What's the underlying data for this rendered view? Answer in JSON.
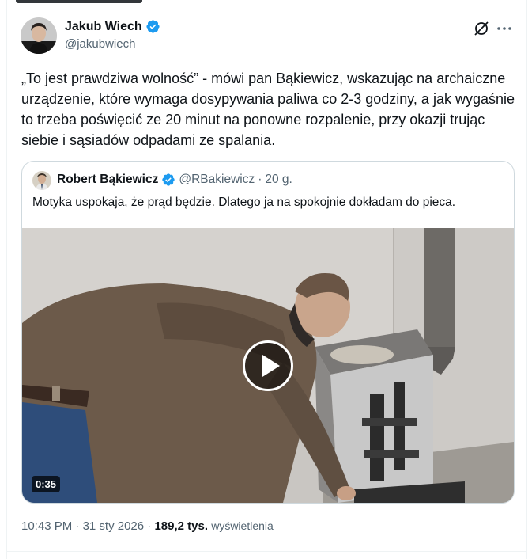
{
  "tweet": {
    "author": {
      "display_name": "Jakub Wiech",
      "handle": "@jakubwiech",
      "verified": true
    },
    "text": "„To jest prawdziwa wolność” - mówi pan Bąkiewicz, wskazując na archaiczne urządzenie, które wymaga dosypywania paliwa co 2-3 godziny, a jak wygaśnie to trzeba poświęcić ze 20 minut na ponowne rozpalenie, przy okazji trując siebie i sąsiadów odpadami ze spalania.",
    "actions": {
      "grok_icon": "grok-icon",
      "more_icon": "more-icon"
    }
  },
  "quote": {
    "author": {
      "display_name": "Robert Bąkiewicz",
      "handle": "@RBakiewicz",
      "separator": "·",
      "time": "20 g.",
      "verified": true
    },
    "text": "Motyka uspokaja, że prąd będzie. Dlatego ja na spokojnie dokładam do pieca.",
    "video": {
      "duration": "0:35",
      "play_icon": "play-icon"
    }
  },
  "meta": {
    "time": "10:43 PM",
    "sep1": "·",
    "date": "31 sty 2026",
    "sep2": "·",
    "views_count": "189,2 tys.",
    "views_label": "wyświetlenia"
  },
  "colors": {
    "text": "#0f1419",
    "secondary": "#536471",
    "border": "#cfd9de",
    "verified": "#1d9bf0"
  }
}
